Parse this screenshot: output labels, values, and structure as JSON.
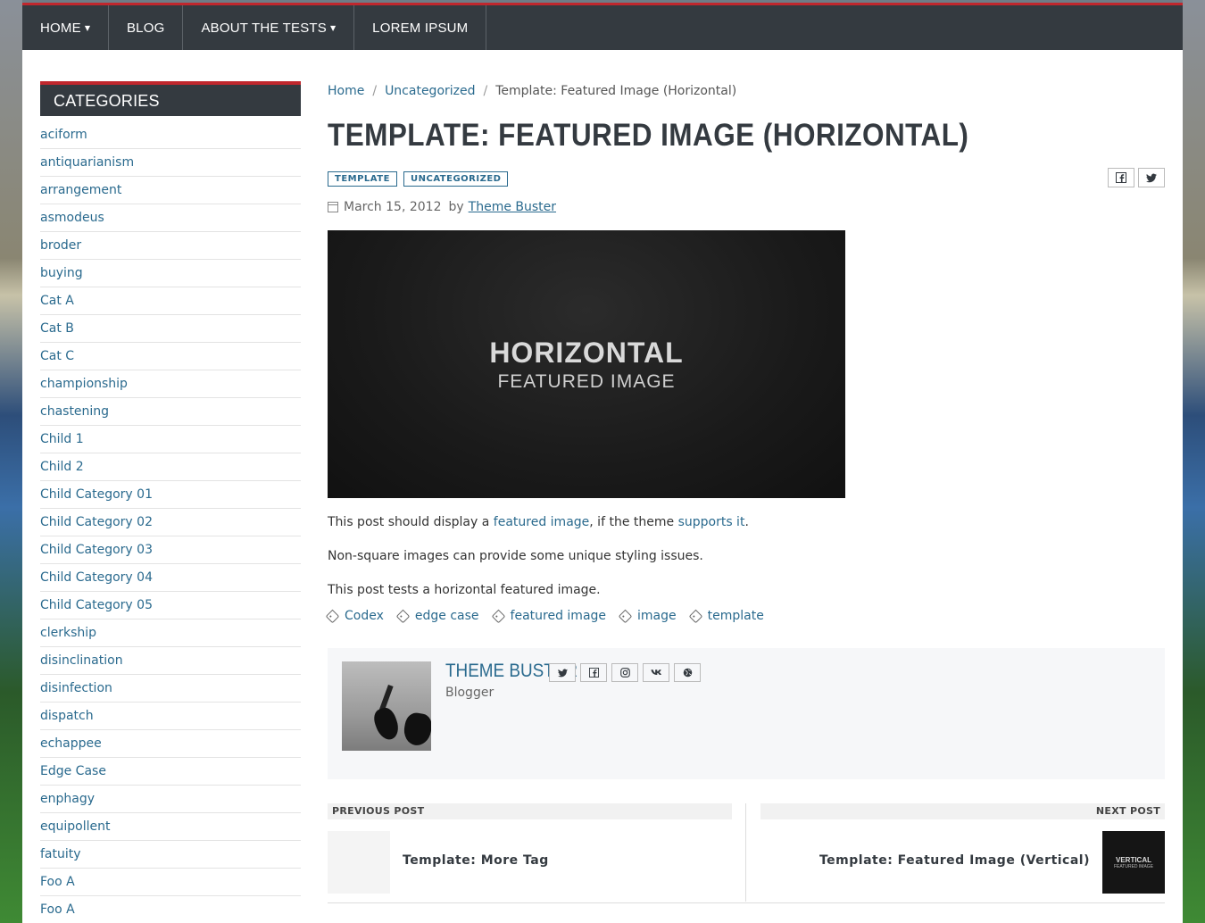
{
  "nav": {
    "items": [
      {
        "label": "HOME",
        "dropdown": true
      },
      {
        "label": "BLOG",
        "dropdown": false
      },
      {
        "label": "ABOUT THE TESTS",
        "dropdown": true
      },
      {
        "label": "LOREM IPSUM",
        "dropdown": false
      }
    ]
  },
  "sidebar": {
    "title": "CATEGORIES",
    "categories": [
      "aciform",
      "antiquarianism",
      "arrangement",
      "asmodeus",
      "broder",
      "buying",
      "Cat A",
      "Cat B",
      "Cat C",
      "championship",
      "chastening",
      "Child 1",
      "Child 2",
      "Child Category 01",
      "Child Category 02",
      "Child Category 03",
      "Child Category 04",
      "Child Category 05",
      "clerkship",
      "disinclination",
      "disinfection",
      "dispatch",
      "echappee",
      "Edge Case",
      "enphagy",
      "equipollent",
      "fatuity",
      "Foo A",
      "Foo A"
    ]
  },
  "breadcrumb": {
    "home": "Home",
    "category": "Uncategorized",
    "current": "Template: Featured Image (Horizontal)",
    "separator": "/"
  },
  "post": {
    "title": "TEMPLATE: FEATURED IMAGE (HORIZONTAL)",
    "badges": [
      "TEMPLATE",
      "UNCATEGORIZED"
    ],
    "date": "March 15, 2012",
    "by": "by",
    "author": "Theme Buster",
    "image_title": "HORIZONTAL",
    "image_subtitle": "FEATURED IMAGE",
    "p1_before": "This post should display a ",
    "p1_link1": "featured image",
    "p1_middle": ", if the theme ",
    "p1_link2": "supports it",
    "p1_after": ".",
    "p2": "Non-square images can provide some unique styling issues.",
    "p3": "This post tests a horizontal featured image.",
    "tags": [
      "Codex",
      "edge case",
      "featured image",
      "image",
      "template"
    ]
  },
  "share": {
    "facebook": "f",
    "twitter": "t"
  },
  "author_box": {
    "name": "THEME BUSTER",
    "role": "Blogger",
    "social": [
      "twitter",
      "facebook",
      "instagram",
      "vk",
      "website"
    ]
  },
  "post_nav": {
    "prev_label": "PREVIOUS POST",
    "prev_title": "Template: More Tag",
    "next_label": "NEXT POST",
    "next_title": "Template: Featured Image (Vertical)",
    "next_thumb_title": "VERTICAL",
    "next_thumb_subtitle": "FEATURED IMAGE"
  },
  "colors": {
    "accent": "#c0272d",
    "nav_bg": "#343a40",
    "link": "#2a6a8e"
  }
}
